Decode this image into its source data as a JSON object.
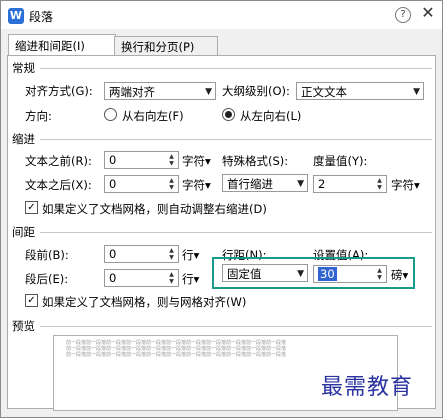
{
  "window": {
    "title": "段落",
    "app_icon": "W"
  },
  "tabs": [
    {
      "label": "缩进和间距(I)"
    },
    {
      "label": "换行和分页(P)"
    }
  ],
  "general": {
    "heading": "常规",
    "alignment": {
      "label": "对齐方式(G):",
      "value": "两端对齐"
    },
    "outline": {
      "label": "大纲级别(O):",
      "value": "正文文本"
    },
    "direction": {
      "label": "方向:",
      "rtl": "从右向左(F)",
      "ltr": "从左向右(L)",
      "selected": "ltr"
    }
  },
  "indent": {
    "heading": "缩进",
    "before": {
      "label": "文本之前(R):",
      "value": "0",
      "unit": "字符"
    },
    "after": {
      "label": "文本之后(X):",
      "value": "0",
      "unit": "字符"
    },
    "special": {
      "label": "特殊格式(S):",
      "value": "首行缩进"
    },
    "measure": {
      "label": "度量值(Y):",
      "value": "2",
      "unit": "字符"
    },
    "auto_adjust": {
      "label": "如果定义了文档网格，则自动调整右缩进(D)",
      "checked": true
    }
  },
  "spacing": {
    "heading": "间距",
    "before": {
      "label": "段前(B):",
      "value": "0",
      "unit": "行"
    },
    "after": {
      "label": "段后(E):",
      "value": "0",
      "unit": "行"
    },
    "line_spacing": {
      "label": "行距(N):",
      "value": "固定值"
    },
    "set_value": {
      "label": "设置值(A):",
      "value": "30",
      "unit": "磅"
    },
    "snap_grid": {
      "label": "如果定义了文档网格，则与网格对齐(W)",
      "checked": true
    }
  },
  "preview": {
    "heading": "预览",
    "lines": [
      "前一段落前一段落前一段落前一段落前一段落前一段落前一段落前一段落前一段落前一段落前一段落",
      "前一段落前一段落前一段落前一段落前一段落前一段落前一段落前一段落前一段落前一段落前一段落",
      "前一段落前一段落前一段落前一段落前一段落前一段落前一段落前一段落前一段落前一段落前一段落"
    ]
  },
  "watermark": "最需教育",
  "colors": {
    "highlight": "#1a9a8a",
    "selection": "#3064d0",
    "watermark": "#2a33a0"
  }
}
